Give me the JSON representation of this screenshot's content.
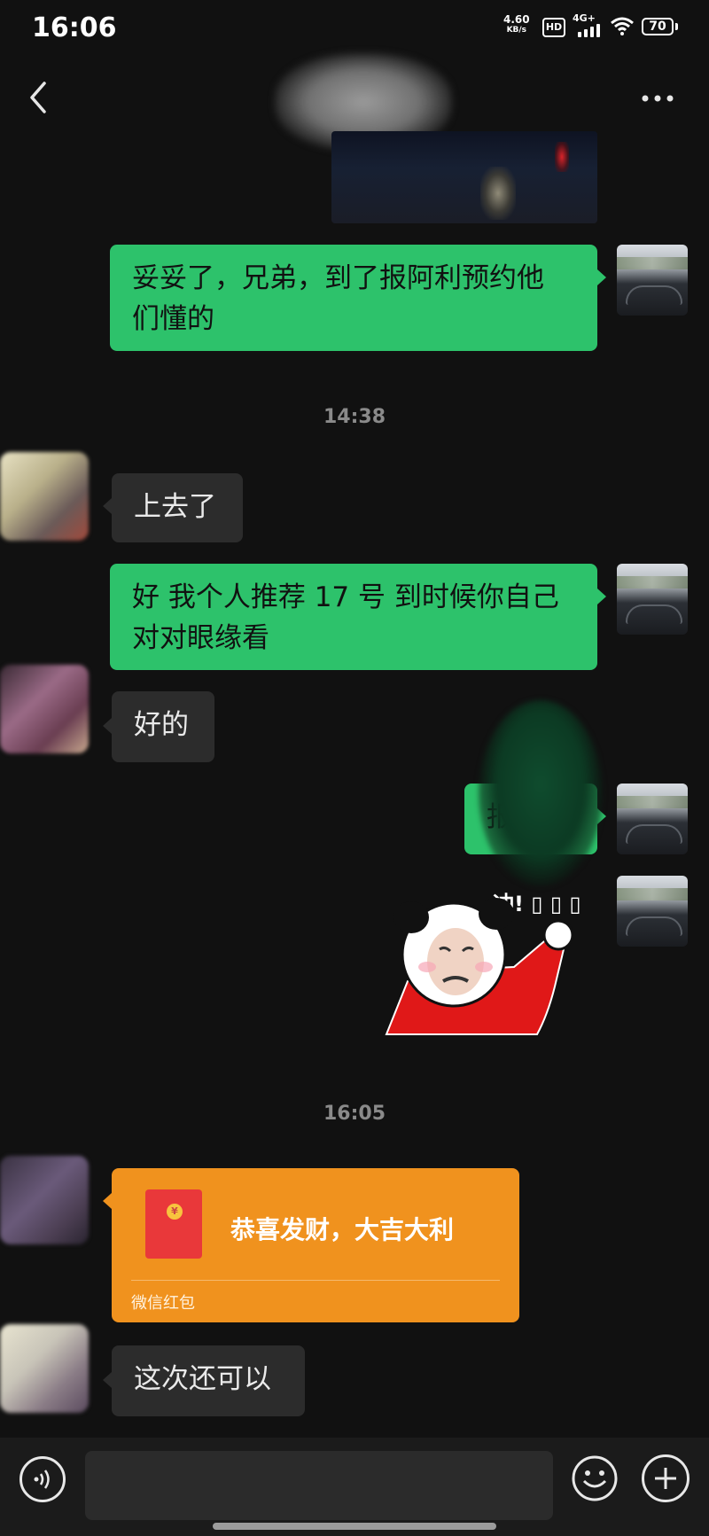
{
  "status_bar": {
    "time": "16:06",
    "net_speed": "4.60",
    "net_unit": "KB/s",
    "hd": "HD",
    "network": "4G+",
    "battery": "70"
  },
  "messages": [
    {
      "side": "right",
      "text": "妥妥了，兄弟，到了报阿利预约他们懂的"
    },
    {
      "timestamp": "14:38"
    },
    {
      "side": "left",
      "text": "上去了"
    },
    {
      "side": "right",
      "text": "好 我个人推荐 17 号 到时候你自己对对眼缘看"
    },
    {
      "side": "left",
      "text": "好的"
    },
    {
      "side": "right",
      "text": "报"
    },
    {
      "side": "right",
      "sticker": "冲!"
    },
    {
      "timestamp": "16:05"
    },
    {
      "side": "left",
      "red_packet": {
        "title": "恭喜发财，大吉大利",
        "label": "微信红包"
      }
    },
    {
      "side": "left",
      "text": "这次还可以"
    }
  ],
  "msg1_line1": "妥妥了，兄弟，到了报阿利预约他",
  "msg1_line2": "们懂的",
  "ts1": "14:38",
  "msg2": "上去了",
  "msg3_line1": "好 我个人推荐 17 号 到时候你自己",
  "msg3_line2": "对对眼缘看",
  "msg4": "好的",
  "msg5": "报",
  "sticker_text": "冲! ▯ ▯ ▯",
  "ts2": "16:05",
  "red_packet": {
    "title": "恭喜发财，大吉大利",
    "label": "微信红包",
    "coin": "¥"
  },
  "msg6": "这次还可以",
  "colors": {
    "my_bubble": "#2dc26b",
    "their_bubble": "#2c2c2c",
    "red_packet": "#f0921e"
  },
  "icons": [
    "back-arrow-icon",
    "more-dots-icon",
    "voice-icon",
    "emoji-icon",
    "plus-icon"
  ]
}
